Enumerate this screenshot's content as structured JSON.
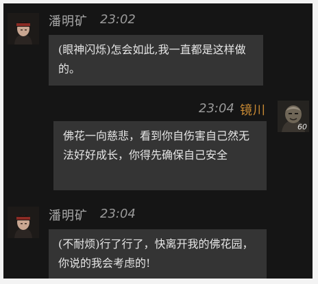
{
  "messages": [
    {
      "speaker": "潘明矿",
      "time": "23:02",
      "text": "(眼神闪烁)怎会如此,我一直都是这样做的。",
      "avatar_icon": "bandana-character-portrait"
    },
    {
      "speaker": "镜川",
      "time": "23:04",
      "text": "佛花一向慈悲，看到你自伤害自己然无法好好成长，你得先确保自己安全",
      "avatar_icon": "armored-character-portrait",
      "level": "60"
    },
    {
      "speaker": "潘明矿",
      "time": "23:04",
      "text": "(不耐烦)行了行了，快离开我的佛花园，你说的我会考虑的!",
      "avatar_icon": "bandana-character-portrait"
    }
  ],
  "colors": {
    "background": "#151515",
    "bubble": "#343434",
    "self_name": "#c98a34"
  }
}
